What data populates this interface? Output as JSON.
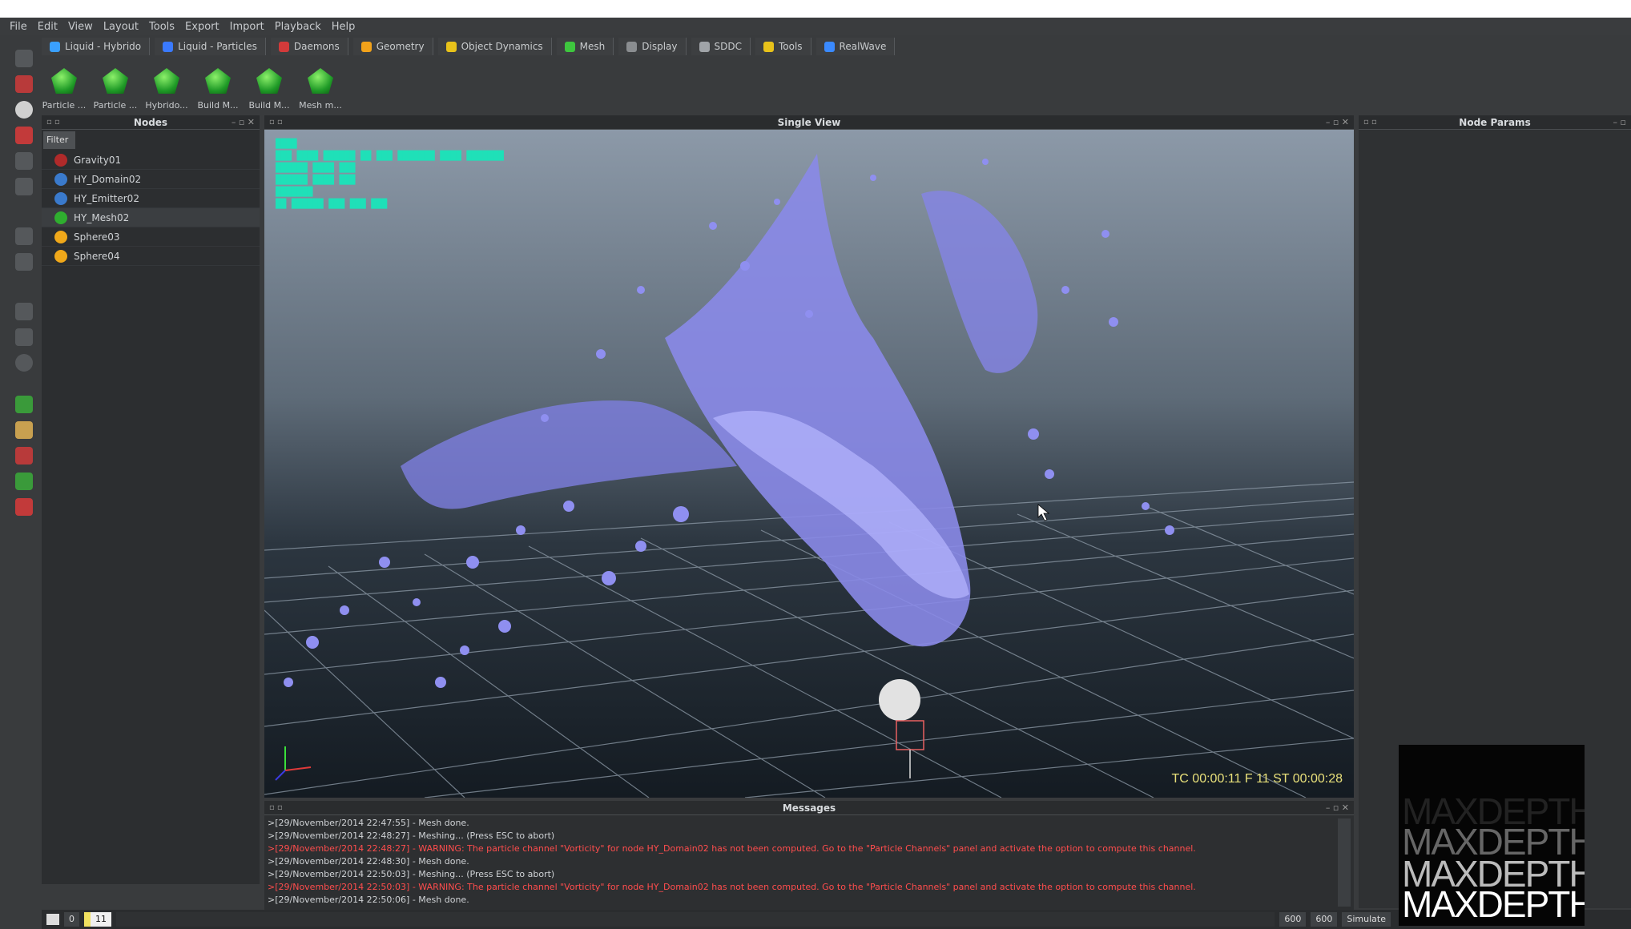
{
  "menu": [
    "File",
    "Edit",
    "View",
    "Layout",
    "Tools",
    "Export",
    "Import",
    "Playback",
    "Help"
  ],
  "tabs": [
    {
      "label": "Liquid - Hybrido",
      "color": "#3aa0ff"
    },
    {
      "label": "Liquid - Particles",
      "color": "#3a7aff"
    },
    {
      "label": "Daemons",
      "color": "#d23a3a"
    },
    {
      "label": "Geometry",
      "color": "#f2a21a"
    },
    {
      "label": "Object Dynamics",
      "color": "#e8c21a"
    },
    {
      "label": "Mesh",
      "color": "#3ec63e"
    },
    {
      "label": "Display",
      "color": "#8a8d90"
    },
    {
      "label": "SDDC",
      "color": "#a0a4a8"
    },
    {
      "label": "Tools",
      "color": "#e8c21a"
    },
    {
      "label": "RealWave",
      "color": "#3a8aff"
    }
  ],
  "shelf": [
    "Particle ...",
    "Particle ...",
    "Hybrido...",
    "Build M...",
    "Build M...",
    "Mesh m..."
  ],
  "nodes_panel": {
    "title": "Nodes",
    "filter": "Filter",
    "items": [
      {
        "label": "Gravity01",
        "color": "#b02a2a"
      },
      {
        "label": "HY_Domain02",
        "color": "#3a7acc"
      },
      {
        "label": "HY_Emitter02",
        "color": "#3a7acc"
      },
      {
        "label": "HY_Mesh02",
        "color": "#2fae2f",
        "selected": true
      },
      {
        "label": "Sphere03",
        "color": "#f0a81a"
      },
      {
        "label": "Sphere04",
        "color": "#f0a81a"
      }
    ]
  },
  "viewport": {
    "title": "Single View",
    "tc": "TC 00:00:11   F 11   ST 00:00:28"
  },
  "node_params": {
    "title": "Node Params"
  },
  "messages": {
    "title": "Messages",
    "lines": [
      {
        "text": ">[29/November/2014 22:47:55] - Mesh done.",
        "warn": false
      },
      {
        "text": ">[29/November/2014 22:48:27] - Meshing... (Press ESC to abort)",
        "warn": false
      },
      {
        "text": ">[29/November/2014 22:48:27] - WARNING: The particle channel \"Vorticity\" for node HY_Domain02 has not been computed. Go to the \"Particle Channels\" panel and activate the option to compute this channel.",
        "warn": true
      },
      {
        "text": ">[29/November/2014 22:48:30] - Mesh done.",
        "warn": false
      },
      {
        "text": ">[29/November/2014 22:50:03] - Meshing... (Press ESC to abort)",
        "warn": false
      },
      {
        "text": ">[29/November/2014 22:50:03] - WARNING: The particle channel \"Vorticity\" for node HY_Domain02 has not been computed. Go to the \"Particle Channels\" panel and activate the option to compute this channel.",
        "warn": true
      },
      {
        "text": ">[29/November/2014 22:50:06] - Mesh done.",
        "warn": false
      }
    ]
  },
  "timeline": {
    "start": "0",
    "current": "11",
    "end_a": "600",
    "end_b": "600",
    "simulate": "Simulate"
  },
  "logo_text": "MAXDEPTH"
}
